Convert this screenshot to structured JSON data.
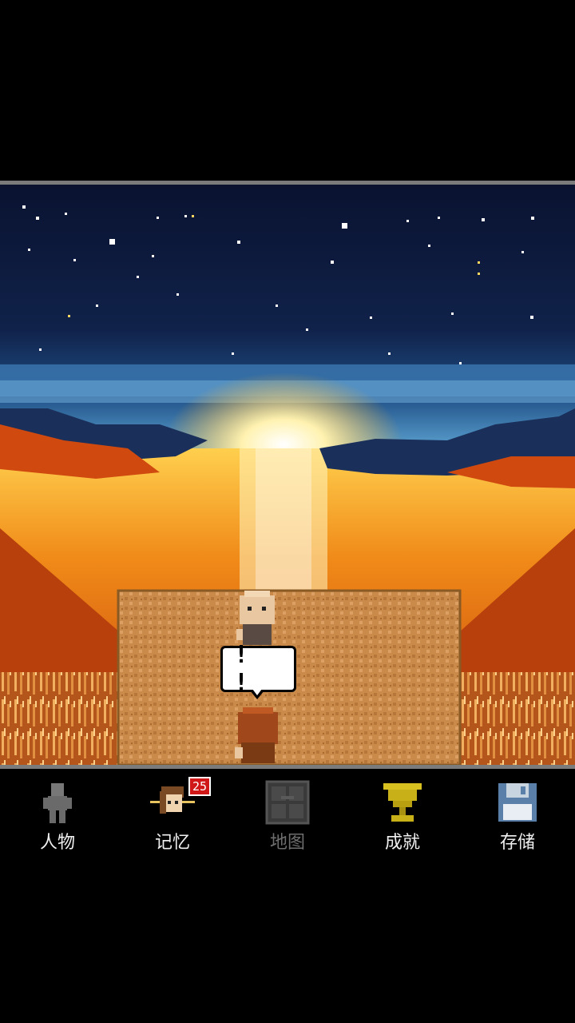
{
  "scene": {
    "speech_bubble_text": "! !"
  },
  "menu": {
    "items": [
      {
        "label": "人物",
        "icon": "character-icon",
        "enabled": true
      },
      {
        "label": "记忆",
        "icon": "memory-icon",
        "enabled": true,
        "badge": "25"
      },
      {
        "label": "地图",
        "icon": "map-icon",
        "enabled": false
      },
      {
        "label": "成就",
        "icon": "trophy-icon",
        "enabled": true
      },
      {
        "label": "存储",
        "icon": "save-icon",
        "enabled": true
      }
    ]
  },
  "colors": {
    "sky": "#0b1330",
    "sunset_orange": "#e86a12",
    "sun_glow": "#ffe27a",
    "field": "#c98a4a",
    "frame_border": "#7b7b7b",
    "badge": "#d01818",
    "disabled_text": "#6e6e6e"
  }
}
